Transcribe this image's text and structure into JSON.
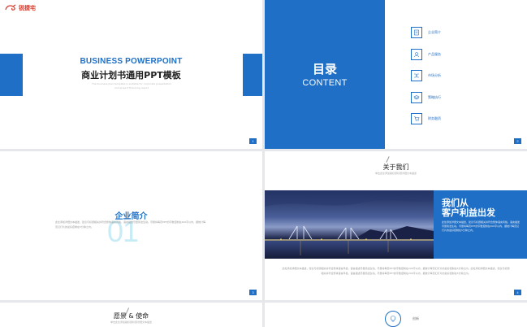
{
  "slide1": {
    "logo_text": "锐捷宅",
    "title_en": "BUSINESS POWERPOINT",
    "title_cn": "商业计划书通用PPT模板",
    "subtitle": "The business plan template is suitable for corporate presentation and project financing report",
    "page": "1"
  },
  "slide2": {
    "toc_cn": "目录",
    "toc_en": "CONTENT",
    "items": [
      {
        "icon": "document-icon",
        "label": "企业简介"
      },
      {
        "icon": "user-icon",
        "label": "产品服务"
      },
      {
        "icon": "shuffle-icon",
        "label": "市场分析"
      },
      {
        "icon": "stack-icon",
        "label": "策略执行"
      },
      {
        "icon": "cart-icon",
        "label": "财务融资"
      }
    ],
    "page": "2"
  },
  "slide3": {
    "big_number": "01",
    "title": "企业简介",
    "body": "此处添加详细文本描述，建议与标题相关并符合整体语言风格，语言描述尽量简洁生动。尽量将每页PPT的字数控制在200字以内，据统计每页幻灯片的最好控制在5分钟之内。",
    "page": "3"
  },
  "slide4": {
    "title": "关于我们",
    "subtitle": "单击此处添加副标题标题详细文本描述",
    "panel_h1": "我们从",
    "panel_h2": "客户利益出发",
    "panel_text": "此处添加详细文本描述，建议与标题相关并符合整体语言风格，语言描述尽量简洁生动。尽量将每页PPT的字数控制在200字以内，据统计每页幻灯片的最好控制在5分钟之内。",
    "body": "此处添加详细文本描述，建议与标题相关并符合整体语言风格，语言描述尽量简洁生动。尽量将每页PPT的字数控制在200字以内，据统计每页幻灯片的最好控制在5分钟之内。此处添加详细文本描述，建议与标题相关并符合整体语言风格，语言描述尽量简洁生动。尽量将每页PPT的字数控制在200字以内，据统计每页幻灯片的最好控制在5分钟之内。",
    "page": "4"
  },
  "slide5": {
    "title": "愿景 & 使命",
    "subtitle": "单击此处添加副标题标题详细文本描述"
  },
  "slide6": {
    "icon": "lightbulb-icon",
    "label": "创新"
  },
  "colors": {
    "accent": "#1f6fc6",
    "background": "#e6e7ea"
  }
}
